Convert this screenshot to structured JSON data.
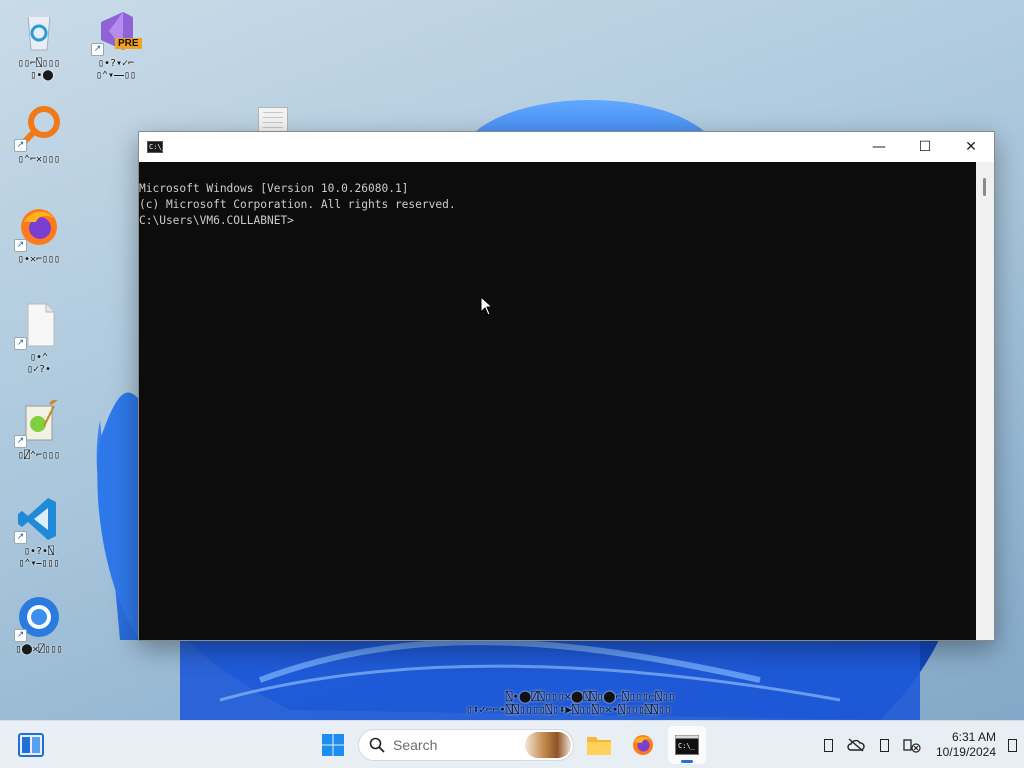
{
  "desktop": {
    "icons": [
      {
        "name": "recycle-bin",
        "caption": "▯▯⌐⍂▯▯▯\n ▯∙⬤"
      },
      {
        "name": "visual-studio-preview",
        "badge": "PRE",
        "caption": "▯∙?▾✓⌐\n▯⌃▾⎯⎯▯▯"
      },
      {
        "name": "search-tool",
        "caption": "▯⌃⌐✕▯▯▯"
      },
      {
        "name": "firefox",
        "caption": "▯∙✕⌐▯▯▯"
      },
      {
        "name": "blank-file",
        "caption": "▯∙⌃\n▯✓?∙"
      },
      {
        "name": "notepad-plus-plus",
        "caption": "▯⍁⌃⌐▯▯▯"
      },
      {
        "name": "visual-studio-code",
        "caption": "▯∙?∙⍂\n▯⌃▾⎯▯▯▯"
      },
      {
        "name": "chrome",
        "caption": "▯⬤✕⍁▯▯▯"
      }
    ],
    "status_strip": "      ⍂∙⬤⍁⍂▯▯▯✕⬤⍂⍂▯⬤⌐⍂▯▯▯⌐⍂▯▯\n▯⬍✓⌐⌐∙⍂⍂▯▯▯▯⍂▯⬍▶⍂▯▯⍂▯✕∙⍂▯▯▯⍂⍂▯▯"
  },
  "console_window": {
    "lines": [
      "Microsoft Windows [Version 10.0.26080.1]",
      "(c) Microsoft Corporation. All rights reserved.",
      "",
      "C:\\Users\\VM6.COLLABNET>"
    ],
    "icon_text": "C:\\_",
    "controls": {
      "minimize": "—",
      "maximize": "☐",
      "close": "✕"
    }
  },
  "taskbar": {
    "search_placeholder": "Search",
    "clock": {
      "time": "6:31 AM",
      "date": "10/19/2024"
    }
  }
}
